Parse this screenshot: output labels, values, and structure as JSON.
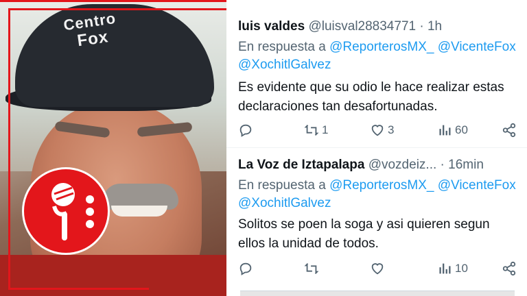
{
  "video": {
    "cap_line1": "Centro",
    "cap_line2": "Fox"
  },
  "tweets": [
    {
      "name": "luis valdes",
      "handle": "@luisval28834771",
      "separator": "·",
      "time": "1h",
      "reply_prefix": "En respuesta a",
      "mentions": [
        "@ReporterosMX_",
        "@VicenteFox",
        "@XochitlGalvez"
      ],
      "text": "Es evidente que su odio le hace realizar estas declaraciones tan desafortunadas.",
      "replies": "",
      "retweets": "1",
      "likes": "3",
      "views": "60"
    },
    {
      "name": "La Voz de Iztapalapa",
      "handle": "@vozdeiz...",
      "separator": "·",
      "time": "16min",
      "reply_prefix": "En respuesta a",
      "mentions": [
        "@ReporterosMX_",
        "@VicenteFox",
        "@XochitlGalvez"
      ],
      "text": "Solitos se poen la soga y asi quieren segun ellos la unidad de todos.",
      "replies": "",
      "retweets": "",
      "likes": "",
      "views": "10"
    }
  ],
  "icons": {
    "reply": "reply-icon",
    "retweet": "retweet-icon",
    "like": "heart-icon",
    "views": "views-icon",
    "share": "share-icon",
    "badge": "microphone-icon"
  },
  "colors": {
    "accent_red": "#e3161b",
    "link_blue": "#1d9bf0",
    "text_primary": "#0f1419",
    "text_secondary": "#536471"
  }
}
